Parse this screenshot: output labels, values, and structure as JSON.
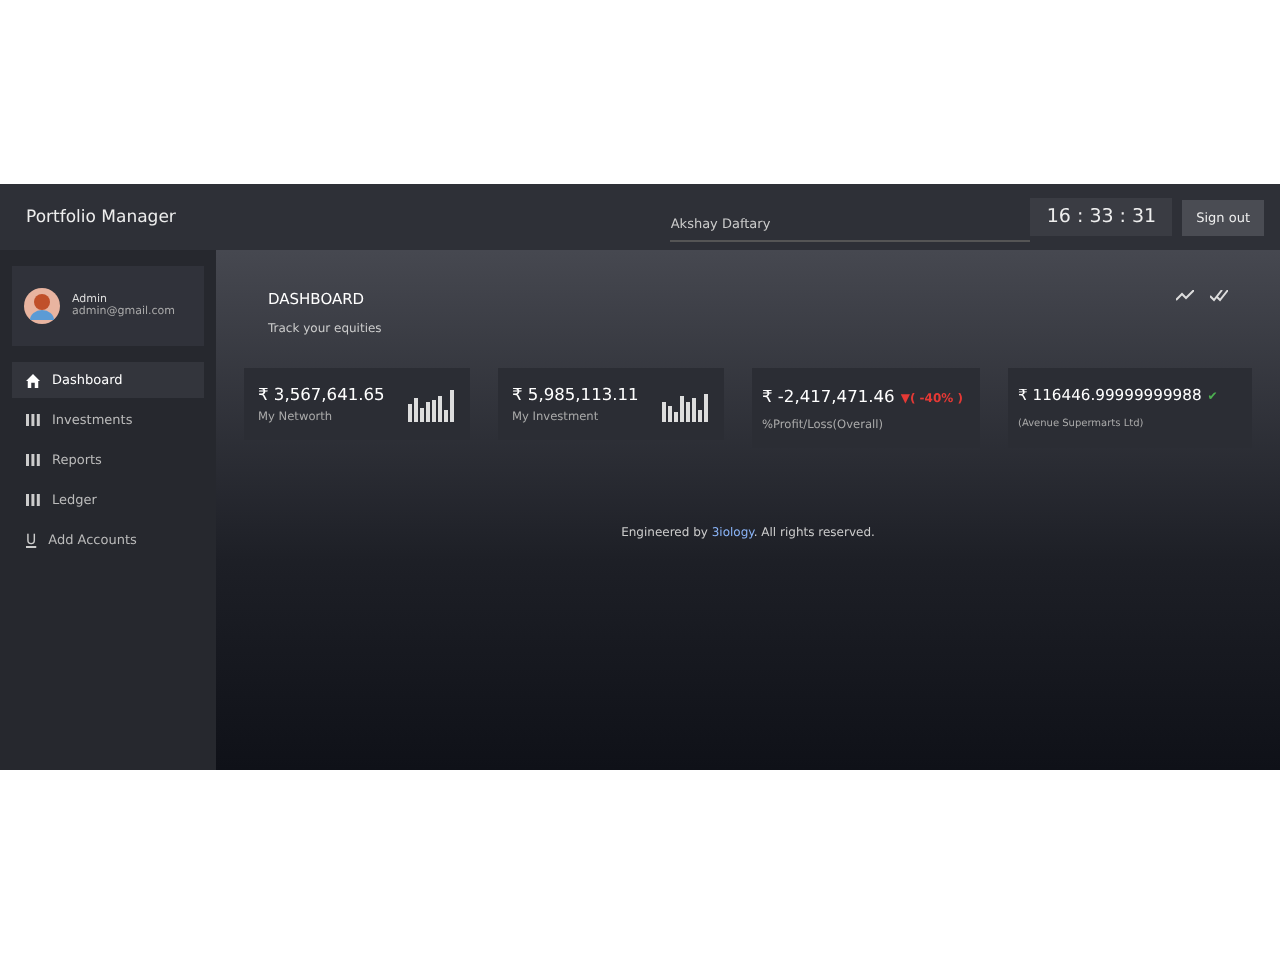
{
  "header": {
    "title": "Portfolio Manager",
    "user_name": "Akshay Daftary",
    "clock": "16 : 33 : 31",
    "sign_out": "Sign out"
  },
  "profile": {
    "name": "Admin",
    "email": "admin@gmail.com"
  },
  "sidebar": {
    "items": [
      {
        "label": "Dashboard",
        "kind": "home",
        "selected": true
      },
      {
        "label": "Investments",
        "kind": "bars",
        "selected": false
      },
      {
        "label": "Reports",
        "kind": "bars",
        "selected": false
      },
      {
        "label": "Ledger",
        "kind": "bars",
        "selected": false
      },
      {
        "label": "Add Accounts",
        "kind": "glyph",
        "glyph": "U",
        "selected": false
      }
    ]
  },
  "page": {
    "title": "DASHBOARD",
    "subtitle": "Track your equities"
  },
  "cards": [
    {
      "kind": "sparkline",
      "value": "₹ 3,567,641.65",
      "label": "My Networth"
    },
    {
      "kind": "sparkline",
      "value": "₹ 5,985,113.11",
      "label": "My Investment"
    },
    {
      "kind": "change",
      "value": "₹ -2,417,471.46",
      "change": "▼( -40% )",
      "color": "#e53935",
      "label": "%Profit/Loss(Overall)"
    },
    {
      "kind": "change",
      "value": "₹ 116446.99999999988",
      "change": "✔",
      "color": "#4caf50",
      "label": "(Avenue Supermarts Ltd)"
    }
  ],
  "footer": {
    "before": "Engineered by ",
    "link": "3iology",
    "after": ". All rights reserved."
  }
}
